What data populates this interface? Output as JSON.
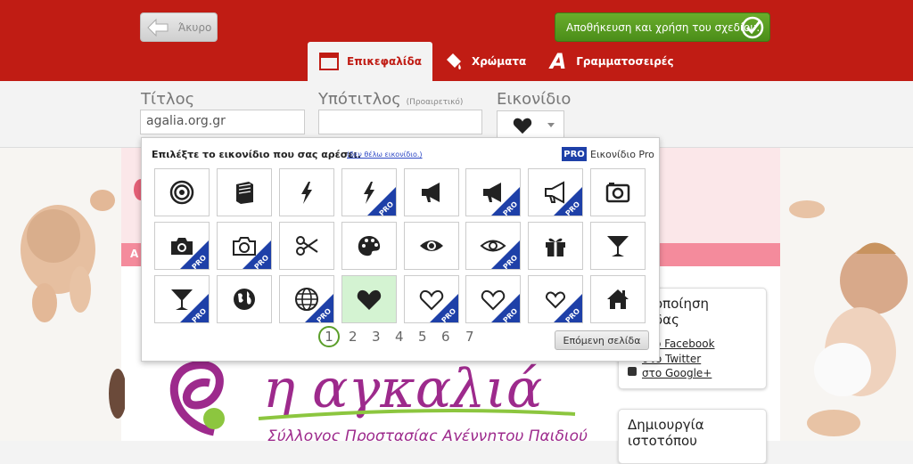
{
  "header": {
    "cancel_label": "Άκυρο",
    "save_label": "Αποθήκευση και χρήση του σχεδίου.",
    "tabs": [
      {
        "label": "Επικεφαλίδα",
        "icon": "header-icon",
        "active": true
      },
      {
        "label": "Χρώματα",
        "icon": "paint-bucket-icon",
        "active": false
      },
      {
        "label": "Γραμματοσειρές",
        "icon": "font-icon",
        "active": false
      }
    ]
  },
  "form": {
    "title_label": "Τίτλος",
    "title_value": "agalia.org.gr",
    "subtitle_label": "Υπότιτλος",
    "subtitle_optional": "(Προαιρετικό)",
    "subtitle_value": "",
    "icon_label": "Εικονίδιο",
    "icon_selected": "heart-icon"
  },
  "icon_picker": {
    "heading": "Επιλέξτε το εικονίδιο που σας αρέσει.",
    "no_icon_link": "(δεν θέλω εικονίδιο.)",
    "pro_badge": "PRO",
    "pro_label": "Εικονίδιο Pro",
    "corner_label": "PRO",
    "icons": [
      {
        "name": "target-icon",
        "pro": false
      },
      {
        "name": "book-icon",
        "pro": false
      },
      {
        "name": "lightning-icon",
        "pro": false
      },
      {
        "name": "lightning-icon",
        "pro": true
      },
      {
        "name": "megaphone-icon",
        "pro": false
      },
      {
        "name": "megaphone-icon",
        "pro": true
      },
      {
        "name": "megaphone-outline-icon",
        "pro": true
      },
      {
        "name": "camera-retro-icon",
        "pro": false
      },
      {
        "name": "camera-icon",
        "pro": true
      },
      {
        "name": "camera-outline-icon",
        "pro": true
      },
      {
        "name": "scissors-icon",
        "pro": false
      },
      {
        "name": "palette-icon",
        "pro": false
      },
      {
        "name": "eye-icon",
        "pro": false
      },
      {
        "name": "eye-outline-icon",
        "pro": true
      },
      {
        "name": "gift-icon",
        "pro": false
      },
      {
        "name": "cocktail-icon",
        "pro": false
      },
      {
        "name": "cocktail-icon",
        "pro": true
      },
      {
        "name": "globe-icon",
        "pro": false
      },
      {
        "name": "globe-outline-icon",
        "pro": true
      },
      {
        "name": "heart-icon",
        "pro": false,
        "selected": true
      },
      {
        "name": "heart-outline-icon",
        "pro": true
      },
      {
        "name": "heart-outline-icon",
        "pro": true
      },
      {
        "name": "heart-outline-small-icon",
        "pro": true
      },
      {
        "name": "home-icon",
        "pro": false
      }
    ],
    "pages": [
      "1",
      "2",
      "3",
      "4",
      "5",
      "6",
      "7"
    ],
    "current_page": "1",
    "next_label": "Επόμενη σελίδα"
  },
  "background": {
    "bar_letter": "Α",
    "share_box": {
      "title_line1": "οποίηση",
      "title_line2": "δας",
      "links": [
        "ο Facebook",
        "στο Twitter",
        "στο Google+"
      ]
    },
    "create_box": {
      "title_line1": "Δημιουργία",
      "title_line2": "ιστοτόπου"
    },
    "logo_text": "η αγκαλιά",
    "logo_subtitle": "Σύλλογος Προστασίας Αγέννητου Παιδιού"
  },
  "colors": {
    "header_red": "#c01c14",
    "save_green": "#5a9d22",
    "pro_blue": "#1e40a8",
    "selected_tile": "#d4f3d2",
    "pink_bar": "#f48b9c"
  }
}
